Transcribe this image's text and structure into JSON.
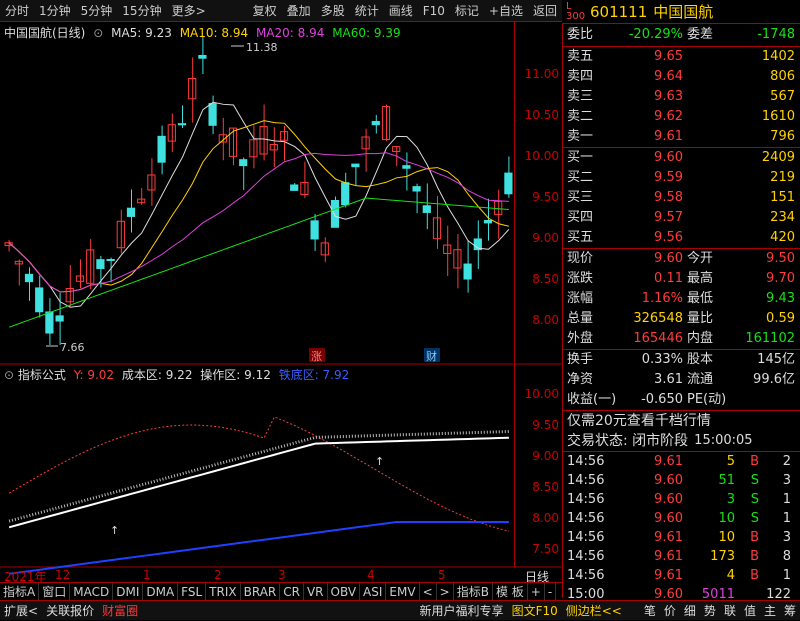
{
  "toolbar": {
    "left_items": [
      "分时",
      "1分钟",
      "5分钟",
      "15分钟",
      "更多>"
    ],
    "right_items": [
      "复权",
      "叠加",
      "多股",
      "统计",
      "画线",
      "F10",
      "标记",
      "+自选",
      "返回"
    ]
  },
  "header": {
    "code": "601111",
    "name": "中国国航",
    "ticker_badge": "L 300"
  },
  "chart": {
    "title": "中国国航(日线)",
    "ma5_label": "MA5: 9.23",
    "ma10_label": "MA10: 8.94",
    "ma20_label": "MA20: 8.94",
    "ma60_label": "MA60: 9.39",
    "high_marker": "11.38",
    "low_marker": "7.66",
    "markers": [
      "涨",
      "财"
    ],
    "y_ticks": [
      "11.00",
      "10.50",
      "10.00",
      "9.50",
      "9.00",
      "8.50",
      "8.00"
    ],
    "x_ticks": [
      "2021年",
      "12",
      "1",
      "2",
      "3",
      "4",
      "5"
    ]
  },
  "indicator": {
    "title": "指标公式",
    "y_label": "Y: 9.02",
    "cost_label": "成本区: 9.22",
    "op_label": "操作区: 9.12",
    "bottom_label": "铁底区: 7.92",
    "y_ticks": [
      "10.00",
      "9.50",
      "9.00",
      "8.50",
      "8.00",
      "7.50"
    ],
    "period": "日线"
  },
  "orderbook": {
    "webi_label": "委比",
    "webi_value": "-20.29%",
    "wecha_label": "委差",
    "wecha_value": "-1748",
    "sells": [
      {
        "label": "卖五",
        "price": "9.65",
        "vol": "1402"
      },
      {
        "label": "卖四",
        "price": "9.64",
        "vol": "806"
      },
      {
        "label": "卖三",
        "price": "9.63",
        "vol": "567"
      },
      {
        "label": "卖二",
        "price": "9.62",
        "vol": "1610"
      },
      {
        "label": "卖一",
        "price": "9.61",
        "vol": "796"
      }
    ],
    "buys": [
      {
        "label": "买一",
        "price": "9.60",
        "vol": "2409"
      },
      {
        "label": "买二",
        "price": "9.59",
        "vol": "219"
      },
      {
        "label": "买三",
        "price": "9.58",
        "vol": "151"
      },
      {
        "label": "买四",
        "price": "9.57",
        "vol": "234"
      },
      {
        "label": "买五",
        "price": "9.56",
        "vol": "420"
      }
    ]
  },
  "quote": {
    "rows": [
      {
        "l1": "现价",
        "v1": "9.60",
        "l2": "今开",
        "v2": "9.50"
      },
      {
        "l1": "涨跌",
        "v1": "0.11",
        "l2": "最高",
        "v2": "9.70"
      },
      {
        "l1": "涨幅",
        "v1": "1.16%",
        "l2": "最低",
        "v2": "9.43"
      },
      {
        "l1": "总量",
        "v1": "326548",
        "l2": "量比",
        "v2": "0.59"
      },
      {
        "l1": "外盘",
        "v1": "165446",
        "l2": "内盘",
        "v2": "161102"
      }
    ],
    "rows2": [
      {
        "l1": "换手",
        "v1": "0.33%",
        "l2": "股本",
        "v2": "145亿"
      },
      {
        "l1": "净资",
        "v1": "3.61",
        "l2": "流通",
        "v2": "99.6亿"
      },
      {
        "l1": "收益(一)",
        "v1": "-0.650",
        "l2": "PE(动)",
        "v2": ""
      }
    ],
    "promo": "仅需20元查看千档行情",
    "trade_state_label": "交易状态: 闭市阶段",
    "trade_state_time": "15:00:05"
  },
  "ticks": [
    {
      "time": "14:56",
      "price": "9.61",
      "vol": "5",
      "side": "B",
      "n": "2"
    },
    {
      "time": "14:56",
      "price": "9.60",
      "vol": "51",
      "side": "S",
      "n": "3"
    },
    {
      "time": "14:56",
      "price": "9.60",
      "vol": "3",
      "side": "S",
      "n": "1"
    },
    {
      "time": "14:56",
      "price": "9.60",
      "vol": "10",
      "side": "S",
      "n": "1"
    },
    {
      "time": "14:56",
      "price": "9.61",
      "vol": "10",
      "side": "B",
      "n": "3"
    },
    {
      "time": "14:56",
      "price": "9.61",
      "vol": "173",
      "side": "B",
      "n": "8"
    },
    {
      "time": "14:56",
      "price": "9.61",
      "vol": "4",
      "side": "B",
      "n": "1"
    },
    {
      "time": "15:00",
      "price": "9.60",
      "vol": "5011",
      "side": "",
      "n": "122"
    }
  ],
  "bottom_tabs": [
    "指标A",
    "窗口",
    "MACD",
    "DMI",
    "DMA",
    "FSL",
    "TRIX",
    "BRAR",
    "CR",
    "VR",
    "OBV",
    "ASI",
    "EMV",
    "<",
    ">",
    "指标B",
    "模 板",
    "+",
    "-"
  ],
  "status_left": [
    "扩展<",
    "关联报价",
    "财富圈"
  ],
  "status_right": [
    "新用户福利专享",
    "图文F10",
    "侧边栏<<"
  ],
  "right_tabs": [
    "笔",
    "价",
    "细",
    "势",
    "联",
    "值",
    "主",
    "筹"
  ],
  "colors": {
    "up": "#ff3b3b",
    "down": "#18e018",
    "accent": "#a00000"
  }
}
